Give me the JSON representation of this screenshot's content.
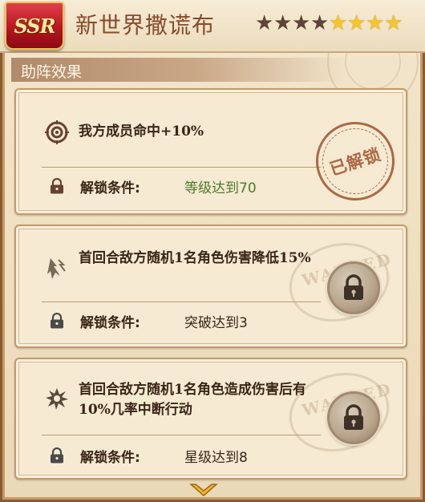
{
  "header": {
    "rarity": "SSR",
    "title": "新世界撒谎布",
    "stars_total": 8,
    "stars_filled": 4,
    "filled_star_color": "#f5c52a",
    "empty_star_color": "#5c4536"
  },
  "section": {
    "title": "助阵效果"
  },
  "skills": [
    {
      "icon": "target-icon",
      "effect": "我方成员命中+10%",
      "condition_label": "解锁条件:",
      "condition_value": "等级达到70",
      "unlocked": true,
      "stamp_text": "已解锁"
    },
    {
      "icon": "debuff-arrow-icon",
      "effect": "首回合敌方随机1名角色伤害降低15%",
      "condition_label": "解锁条件:",
      "condition_value": "突破达到3",
      "unlocked": false
    },
    {
      "icon": "burst-icon",
      "effect": "首回合敌方随机1名角色造成伤害后有10%几率中断行动",
      "condition_label": "解锁条件:",
      "condition_value": "星级达到8",
      "unlocked": false
    }
  ],
  "watermark_text": "WANTED",
  "scroll_icon": "chevron-down-icon"
}
